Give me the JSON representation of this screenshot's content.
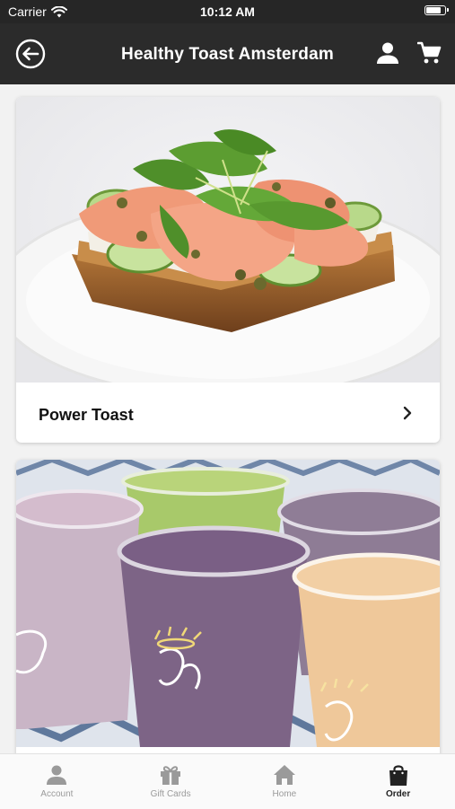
{
  "status_bar": {
    "carrier": "Carrier",
    "time": "10:12 AM",
    "battery_level": 0.9
  },
  "header": {
    "title": "Healthy Toast Amsterdam",
    "back_icon": "arrow-left-circle-icon",
    "user_icon": "user-icon",
    "cart_icon": "cart-icon"
  },
  "cards": [
    {
      "label": "Power Toast",
      "image": "salmon-avocado-toast-photo"
    },
    {
      "label": "",
      "image": "smoothie-cups-photo"
    }
  ],
  "tabs": [
    {
      "label": "Account",
      "icon": "account-icon",
      "active": false
    },
    {
      "label": "Gift Cards",
      "icon": "gift-icon",
      "active": false
    },
    {
      "label": "Home",
      "icon": "home-icon",
      "active": false
    },
    {
      "label": "Order",
      "icon": "shopping-bag-icon",
      "active": true
    }
  ],
  "colors": {
    "header_bg": "#2b2b2b",
    "active_tab": "#222222",
    "inactive_tab": "#9a9a9a"
  }
}
